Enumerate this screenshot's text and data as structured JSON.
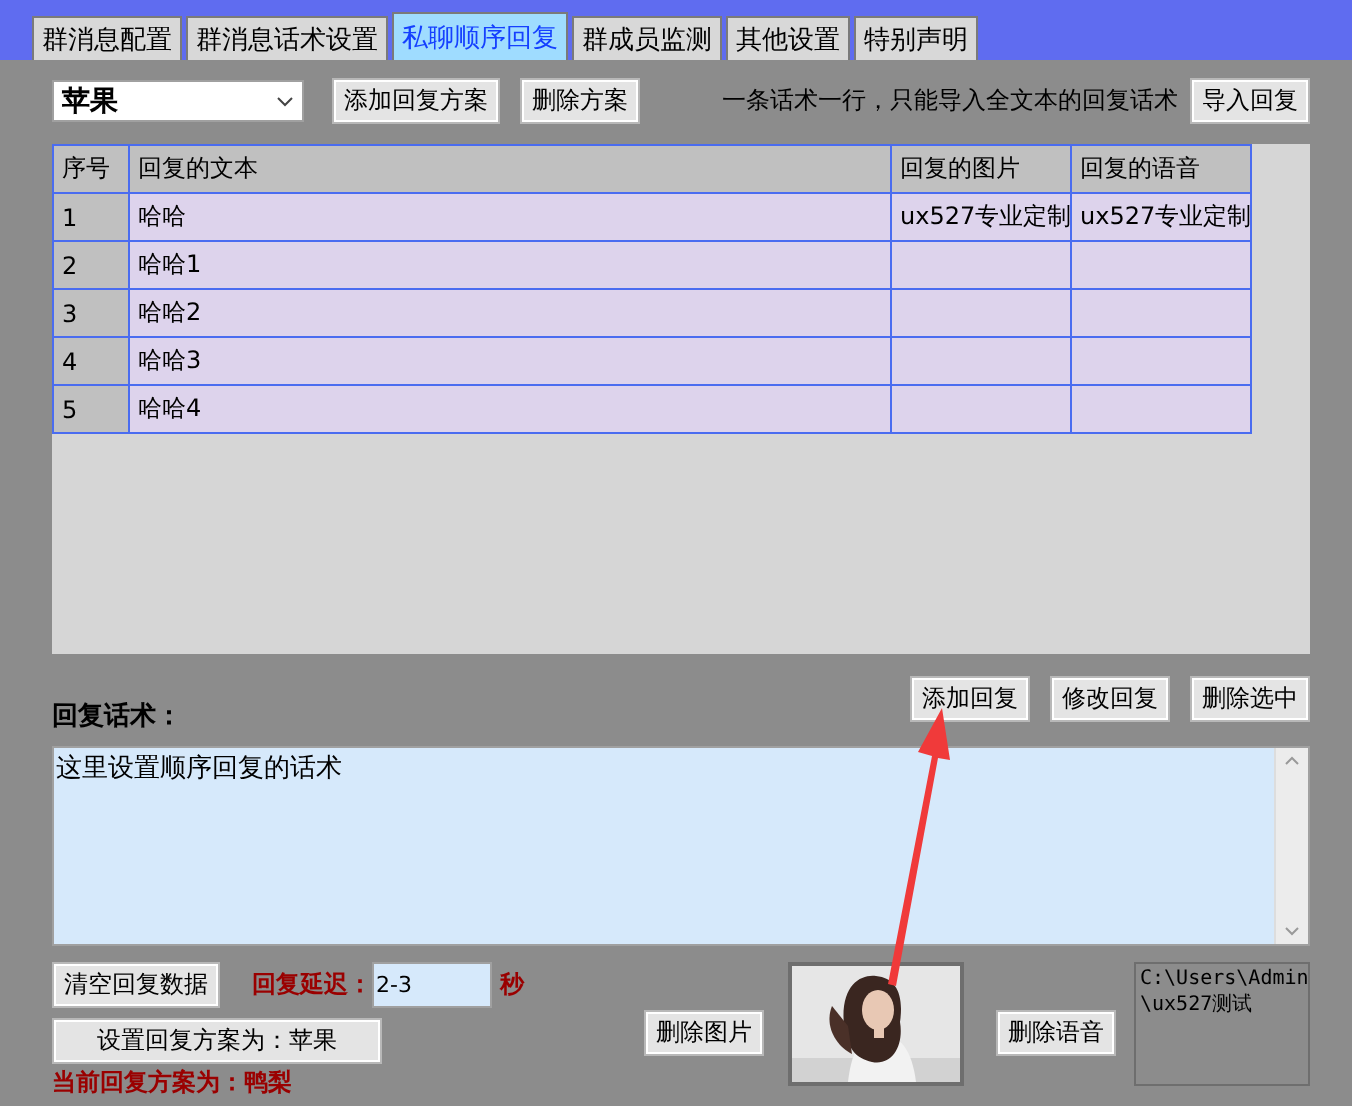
{
  "tabs": [
    {
      "label": "群消息配置",
      "selected": false
    },
    {
      "label": "群消息话术设置",
      "selected": false
    },
    {
      "label": "私聊顺序回复",
      "selected": true
    },
    {
      "label": "群成员监测",
      "selected": false
    },
    {
      "label": "其他设置",
      "selected": false
    },
    {
      "label": "特别声明",
      "selected": false
    }
  ],
  "scheme_select": {
    "value": "苹果"
  },
  "toolbar_buttons": [
    "添加回复方案",
    "删除方案"
  ],
  "import_hint": "一条话术一行，只能导入全文本的回复话术",
  "import_button": "导入回复",
  "table": {
    "columns": [
      "序号",
      "回复的文本",
      "回复的图片",
      "回复的语音"
    ],
    "rows": [
      [
        "1",
        "哈哈",
        "ux527专业定制",
        "ux527专业定制"
      ],
      [
        "2",
        "哈哈1",
        "",
        ""
      ],
      [
        "3",
        "哈哈2",
        "",
        ""
      ],
      [
        "4",
        "哈哈3",
        "",
        ""
      ],
      [
        "5",
        "哈哈4",
        "",
        ""
      ]
    ]
  },
  "reply_label": "回复话术：",
  "reply_buttons": [
    "添加回复",
    "修改回复",
    "删除选中"
  ],
  "reply_text": "这里设置顺序回复的话术",
  "clear_button": "清空回复数据",
  "delay_label": "回复延迟：",
  "delay_value": "2-3",
  "delay_unit": "秒",
  "set_scheme_button": "设置回复方案为：苹果",
  "current_scheme": "当前回复方案为：鸭梨",
  "delete_image_button": "删除图片",
  "image": {
    "kind": "picture"
  },
  "delete_voice_button": "删除语音",
  "voice_path": [
    "C:\\Users\\Admin",
    "\\ux527测试"
  ]
}
